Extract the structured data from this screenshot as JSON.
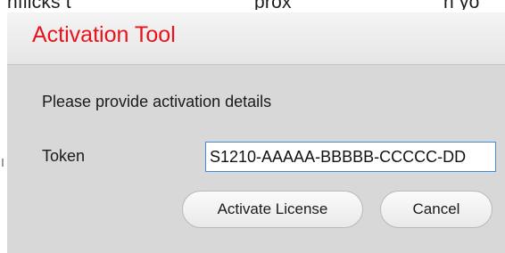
{
  "background": {
    "partial_text_left": "nflicks t",
    "partial_text_mid": "prox",
    "partial_text_right": "h yo"
  },
  "dialog": {
    "title": "Activation Tool",
    "title_color": "#e8141a",
    "background_color": "#d8d8d8",
    "prompt": "Please provide activation details",
    "token_label": "Token",
    "token_value": "S1210-AAAAA-BBBBB-CCCCC-DD",
    "input_border_color": "#3c8fd4",
    "activate_label": "Activate License",
    "cancel_label": "Cancel"
  }
}
